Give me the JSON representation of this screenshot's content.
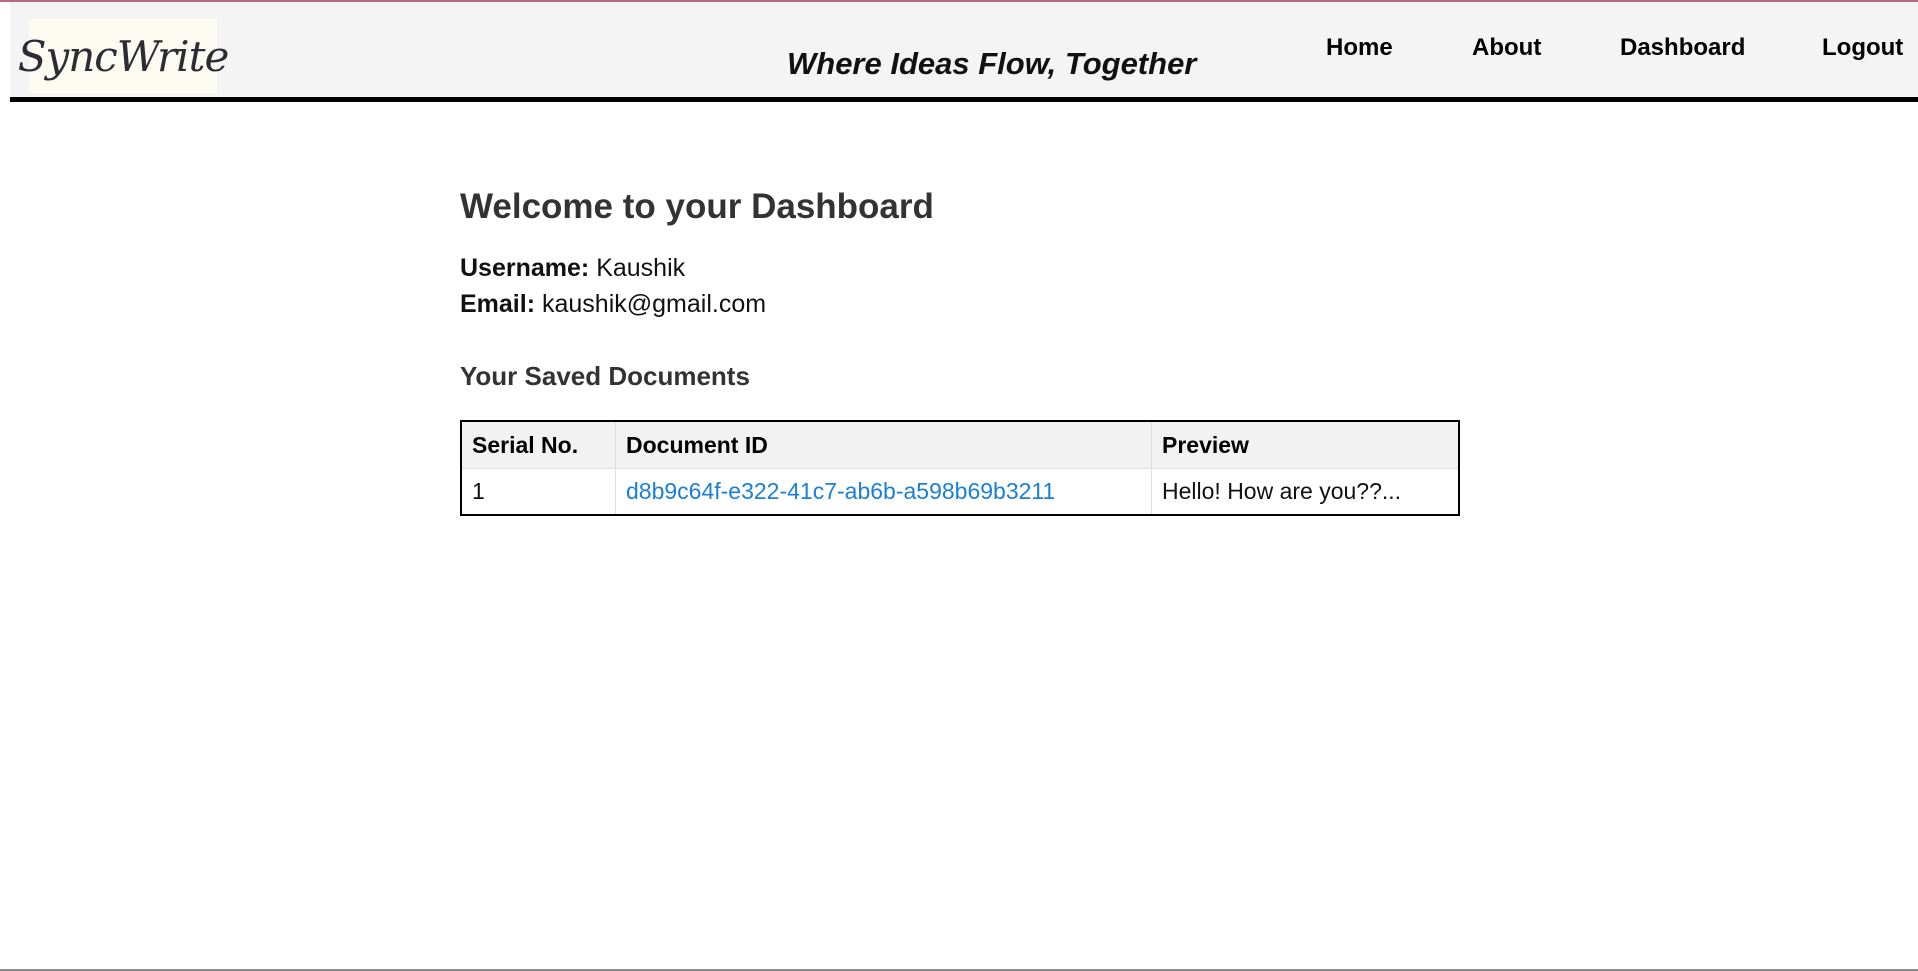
{
  "header": {
    "logo_text": "SyncWrite",
    "tagline": "Where Ideas Flow, Together",
    "nav": {
      "home": "Home",
      "about": "About",
      "dashboard": "Dashboard",
      "logout": "Logout"
    }
  },
  "main": {
    "title": "Welcome to your Dashboard",
    "username_label": "Username:",
    "username_value": "Kaushik",
    "email_label": "Email:",
    "email_value": "kaushik@gmail.com",
    "documents_title": "Your Saved Documents",
    "table": {
      "headers": [
        "Serial No.",
        "Document ID",
        "Preview"
      ],
      "rows": [
        {
          "serial": "1",
          "document_id": "d8b9c64f-e322-41c7-ab6b-a598b69b3211",
          "preview": "Hello! How are you??..."
        }
      ]
    }
  },
  "colors": {
    "link": "#1a7fd6",
    "navbar_bg": "#f4f4f4",
    "accent_line": "#b56a86"
  }
}
